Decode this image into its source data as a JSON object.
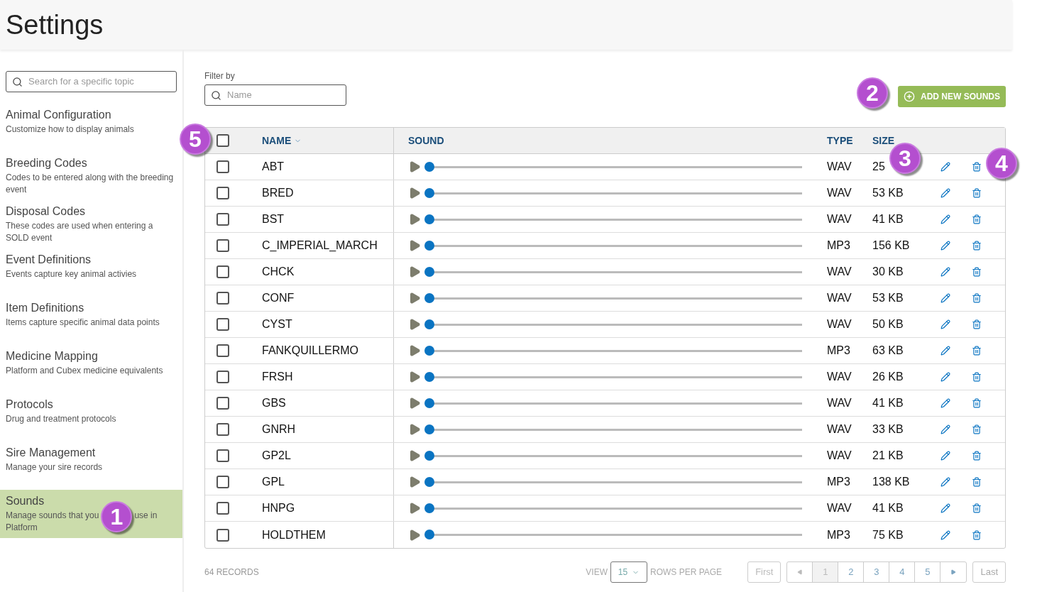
{
  "page_title": "Settings",
  "sidebar": {
    "search_placeholder": "Search for a specific topic",
    "items": [
      {
        "title": "Animal Configuration",
        "description": "Customize how to display animals",
        "selected": false
      },
      {
        "title": "Breeding Codes",
        "description": "Codes to be entered along with the breeding event",
        "selected": false
      },
      {
        "title": "Disposal Codes",
        "description": "These codes are used when entering a SOLD event",
        "selected": false
      },
      {
        "title": "Event Definitions",
        "description": "Events capture key animal activies",
        "selected": false
      },
      {
        "title": "Item Definitions",
        "description": "Items capture specific animal data points",
        "selected": false
      },
      {
        "title": "Medicine Mapping",
        "description": "Platform and Cubex medicine equivalents",
        "selected": false
      },
      {
        "title": "Protocols",
        "description": "Drug and treatment protocols",
        "selected": false
      },
      {
        "title": "Sire Management",
        "description": "Manage your sire records",
        "selected": false
      },
      {
        "title": "Sounds",
        "description": "Manage sounds that you",
        "description_continued": "use in",
        "description_last_line": "Platform",
        "callout": "1",
        "selected": true
      }
    ]
  },
  "filter": {
    "label": "Filter by",
    "placeholder": "Name"
  },
  "add_button": {
    "label": "ADD NEW SOUNDS",
    "callout": "2"
  },
  "table": {
    "select_all_checked": false,
    "select_callout": "5",
    "columns": [
      "NAME",
      "SOUND",
      "TYPE",
      "SIZE"
    ],
    "rows": [
      {
        "name": "ABT",
        "type": "WAV",
        "size": "25",
        "level": 0,
        "checked": false,
        "size_callout": "3",
        "delete_callout": "4"
      },
      {
        "name": "BRED",
        "type": "WAV",
        "size": "53 KB",
        "level": 0,
        "checked": false
      },
      {
        "name": "BST",
        "type": "WAV",
        "size": "41 KB",
        "level": 0,
        "checked": false
      },
      {
        "name": "C_IMPERIAL_MARCH",
        "type": "MP3",
        "size": "156 KB",
        "level": 0,
        "checked": false
      },
      {
        "name": "CHCK",
        "type": "WAV",
        "size": "30 KB",
        "level": 0,
        "checked": false
      },
      {
        "name": "CONF",
        "type": "WAV",
        "size": "53 KB",
        "level": 0,
        "checked": false
      },
      {
        "name": "CYST",
        "type": "WAV",
        "size": "50 KB",
        "level": 0,
        "checked": false
      },
      {
        "name": "FANKQUILLERMO",
        "type": "MP3",
        "size": "63 KB",
        "level": 0,
        "checked": false
      },
      {
        "name": "FRSH",
        "type": "WAV",
        "size": "26 KB",
        "level": 0,
        "checked": false
      },
      {
        "name": "GBS",
        "type": "WAV",
        "size": "41 KB",
        "level": 0,
        "checked": false
      },
      {
        "name": "GNRH",
        "type": "WAV",
        "size": "33 KB",
        "level": 0,
        "checked": false
      },
      {
        "name": "GP2L",
        "type": "WAV",
        "size": "21 KB",
        "level": 0,
        "checked": false
      },
      {
        "name": "GPL",
        "type": "MP3",
        "size": "138 KB",
        "level": 0,
        "checked": false
      },
      {
        "name": "HNPG",
        "type": "WAV",
        "size": "41 KB",
        "level": 0,
        "checked": false
      },
      {
        "name": "HOLDTHEM",
        "type": "MP3",
        "size": "75 KB",
        "level": 0,
        "checked": false
      }
    ]
  },
  "footer": {
    "records": "64 RECORDS",
    "view_label": "VIEW",
    "rows_per_page": "15",
    "rows_label": "ROWS PER PAGE",
    "first": "First",
    "last": "Last",
    "pages": [
      {
        "label": "1",
        "selected": true
      },
      {
        "label": "2",
        "selected": false
      },
      {
        "label": "3",
        "selected": false
      },
      {
        "label": "4",
        "selected": false
      },
      {
        "label": "5",
        "selected": false
      }
    ]
  }
}
